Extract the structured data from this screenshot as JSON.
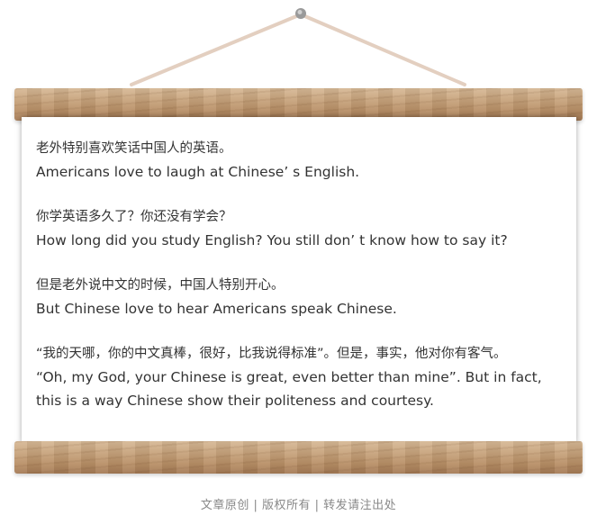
{
  "scroll": {
    "paragraphs": [
      {
        "zh": "老外特别喜欢笑话中国人的英语。",
        "en": "Americans love to laugh at Chinese’ s English."
      },
      {
        "zh": "你学英语多久了？你还没有学会？",
        "en": "How long did you study English? You still don’ t know how to say it?"
      },
      {
        "zh": "但是老外说中文的时候，中国人特别开心。",
        "en": "But Chinese love to hear Americans speak Chinese."
      },
      {
        "zh": "“我的天哪，你的中文真棒，很好，比我说得标准”。但是，事实，他对你有客气。",
        "en": "“Oh, my God, your Chinese is great, even better than mine”. But in fact, this is a way Chinese show their politeness and courtesy."
      }
    ]
  },
  "footer": {
    "text": "文章原创 | 版权所有 | 转发请注出处"
  }
}
